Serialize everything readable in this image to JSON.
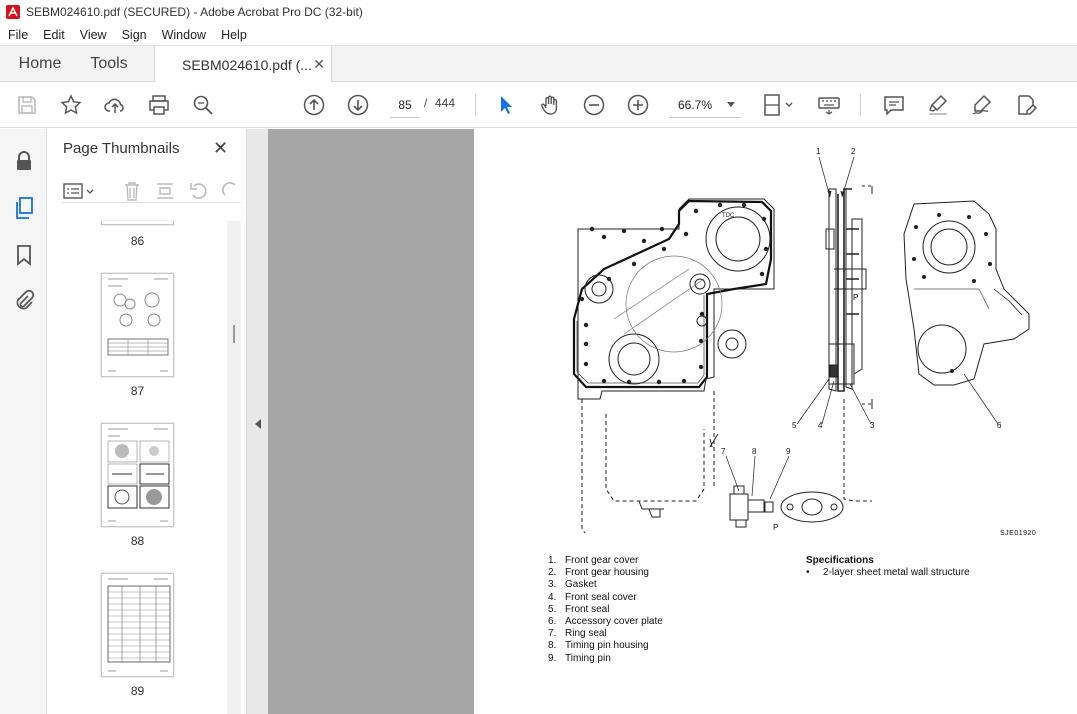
{
  "window": {
    "title": "SEBM024610.pdf (SECURED) - Adobe Acrobat Pro DC (32-bit)"
  },
  "menu": [
    "File",
    "Edit",
    "View",
    "Sign",
    "Window",
    "Help"
  ],
  "tabs": {
    "home": "Home",
    "tools": "Tools",
    "document": "SEBM024610.pdf (..."
  },
  "toolbar": {
    "current_page": "85",
    "page_separator": "/",
    "total_pages": "444",
    "zoom": "66.7%"
  },
  "thumbnails_panel": {
    "title": "Page Thumbnails",
    "pages": [
      "86",
      "87",
      "88",
      "89"
    ]
  },
  "document_page": {
    "callouts": [
      "1",
      "2",
      "3",
      "4",
      "5",
      "6",
      "7",
      "8",
      "9",
      "P",
      "P"
    ],
    "figure_code": "SJE01920",
    "parts": [
      {
        "num": "1.",
        "name": "Front gear cover"
      },
      {
        "num": "2.",
        "name": "Front gear housing"
      },
      {
        "num": "3.",
        "name": "Gasket"
      },
      {
        "num": "4.",
        "name": "Front seal cover"
      },
      {
        "num": "5.",
        "name": "Front seal"
      },
      {
        "num": "6.",
        "name": "Accessory cover plate"
      },
      {
        "num": "7.",
        "name": "Ring seal"
      },
      {
        "num": "8.",
        "name": "Timing pin housing"
      },
      {
        "num": "9.",
        "name": "Timing pin"
      }
    ],
    "specifications_heading": "Specifications",
    "specifications": [
      {
        "bullet": "•",
        "text": "2-layer sheet metal wall structure"
      }
    ]
  },
  "colors": {
    "acrobat_red": "#d4141b",
    "select_blue": "#1473e6",
    "viewer_gray": "#a6a6a6"
  }
}
